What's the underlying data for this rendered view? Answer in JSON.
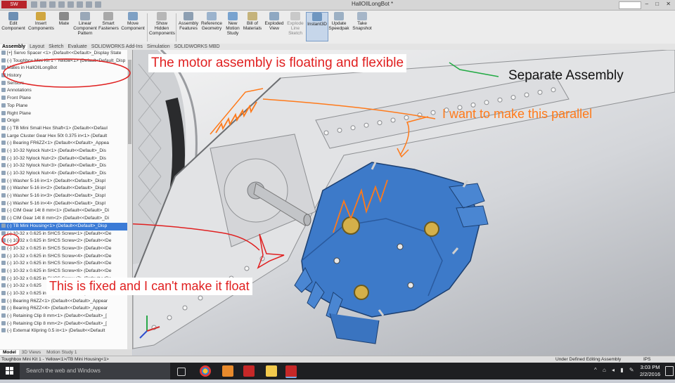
{
  "app": {
    "document_title": "HallOIlLongBot *",
    "window_controls": "– □ ✕"
  },
  "ribbon": {
    "buttons": [
      {
        "label": "Edit Component",
        "icon": "edit-component-icon"
      },
      {
        "label": "Insert Components",
        "icon": "insert-components-icon"
      },
      {
        "label": "Mate",
        "icon": "mate-icon"
      },
      {
        "label": "Linear Component Pattern",
        "icon": "linear-pattern-icon"
      },
      {
        "label": "Smart Fasteners",
        "icon": "smart-fasteners-icon"
      },
      {
        "label": "Move Component",
        "icon": "move-component-icon"
      },
      {
        "label": "Show Hidden Components",
        "icon": "show-hidden-icon"
      },
      {
        "label": "Assembly Features",
        "icon": "assembly-features-icon"
      },
      {
        "label": "Reference Geometry",
        "icon": "reference-geometry-icon"
      },
      {
        "label": "New Motion Study",
        "icon": "motion-study-icon"
      },
      {
        "label": "Bill of Materials",
        "icon": "bom-icon"
      },
      {
        "label": "Exploded View",
        "icon": "exploded-view-icon"
      },
      {
        "label": "Explode Line Sketch",
        "icon": "explode-line-icon"
      },
      {
        "label": "Instant3D",
        "icon": "instant3d-icon"
      },
      {
        "label": "Update Speedpak",
        "icon": "speedpak-icon"
      },
      {
        "label": "Take Snapshot",
        "icon": "snapshot-icon"
      }
    ]
  },
  "command_tabs": [
    "Assembly",
    "Layout",
    "Sketch",
    "Evaluate",
    "SOLIDWORKS Add-Ins",
    "Simulation",
    "SOLIDWORKS MBD"
  ],
  "tree": {
    "items": [
      "[+] Servo Spacer <1> (Default<<Default>_Display State",
      "(-) Toughbox Mini Kit 1 - Yellow<1> (Default<Default_Disp",
      "Mates in HallOIlLongBot",
      "History",
      "Sensors",
      "Annotations",
      "Front Plane",
      "Top Plane",
      "Right Plane",
      "Origin",
      "(-) TB Mini Small Hex Shaft<1> (Default<<Defaul",
      "Large Cluster Gear Hex 50t 0.375 in<1> (Default",
      "(-) Bearing FR6ZZ<1> (Default<<Default>_Appea",
      "(-) 10-32 Nylock Nut<1> (Default<<Default>_Dis",
      "(-) 10-32 Nylock Nut<2> (Default<<Default>_Dis",
      "(-) 10-32 Nylock Nut<3> (Default<<Default>_Dis",
      "(-) 10-32 Nylock Nut<4> (Default<<Default>_Dis",
      "(-) Washer 5-16 in<1> (Default<<Default>_Displ",
      "(-) Washer 5-16 in<2> (Default<<Default>_Displ",
      "(-) Washer 5-16 in<3> (Default<<Default>_Displ",
      "(-) Washer 5-16 in<4> (Default<<Default>_Displ",
      "(-) CIM Gear 14t 8 mm<1> (Default<<Default>_Di",
      "(-) CIM Gear 14t 8 mm<2> (Default<<Default>_Di",
      "(-) TB Mini Housing<1> (Default<<Default>_Disp",
      "(-) 10-32 x 0.625 in SHCS Screw<1> (Default<<De",
      "(-) 10-32 x 0.625 in SHCS Screw<2> (Default<<De",
      "(-) 10-32 x 0.625 in SHCS Screw<3> (Default<<De",
      "(-) 10-32 x 0.625 in SHCS Screw<4> (Default<<De",
      "(-) 10-32 x 0.625 in SHCS Screw<5> (Default<<De",
      "(-) 10-32 x 0.625 in SHCS Screw<6> (Default<<De",
      "(-) 10-32 x 0.625 in SHCS Screw<7> (Default<<De",
      "(-) 10-32 x 0.625",
      "(-) 10-32 x 0.625 in SHCS Screw<8> (Default<<De",
      "(-) Bearing R6ZZ<1> (Default<<Default>_Appear",
      "(-) Bearing R6ZZ<4> (Default<<Default>_Appear",
      "(-) Retaining Clip 8 mm<1> (Default<<Default>_[",
      "(-) Retaining Clip 8 mm<2> (Default<<Default>_[",
      "(-) External Klipring 0.5 in<1> (Default<<Default"
    ],
    "selected_index": 23
  },
  "tree_tabs": [
    "Model",
    "3D Views",
    "Motion Study 1"
  ],
  "annotations": {
    "floating": "The motor assembly is floating and flexible",
    "separate": "Separate Assembly",
    "parallel": "I want to make this parallel",
    "fixed": "This is fixed and I can't make it float"
  },
  "status": {
    "path": "Toughbox Mini Kit 1 - Yellow<1>/TB Mini Housing<1>",
    "state": "Under Defined   Editing Assembly",
    "units": "IPS"
  },
  "taskbar": {
    "search_placeholder": "Search the web and Windows",
    "time": "3:03 PM",
    "date": "2/2/2016"
  },
  "colors": {
    "annotation_red": "#e02020",
    "annotation_orange": "#ff7a1a",
    "annotation_green": "#22aa44",
    "housing_blue": "#3d7ac9",
    "selection_blue": "#3b7bd6"
  }
}
